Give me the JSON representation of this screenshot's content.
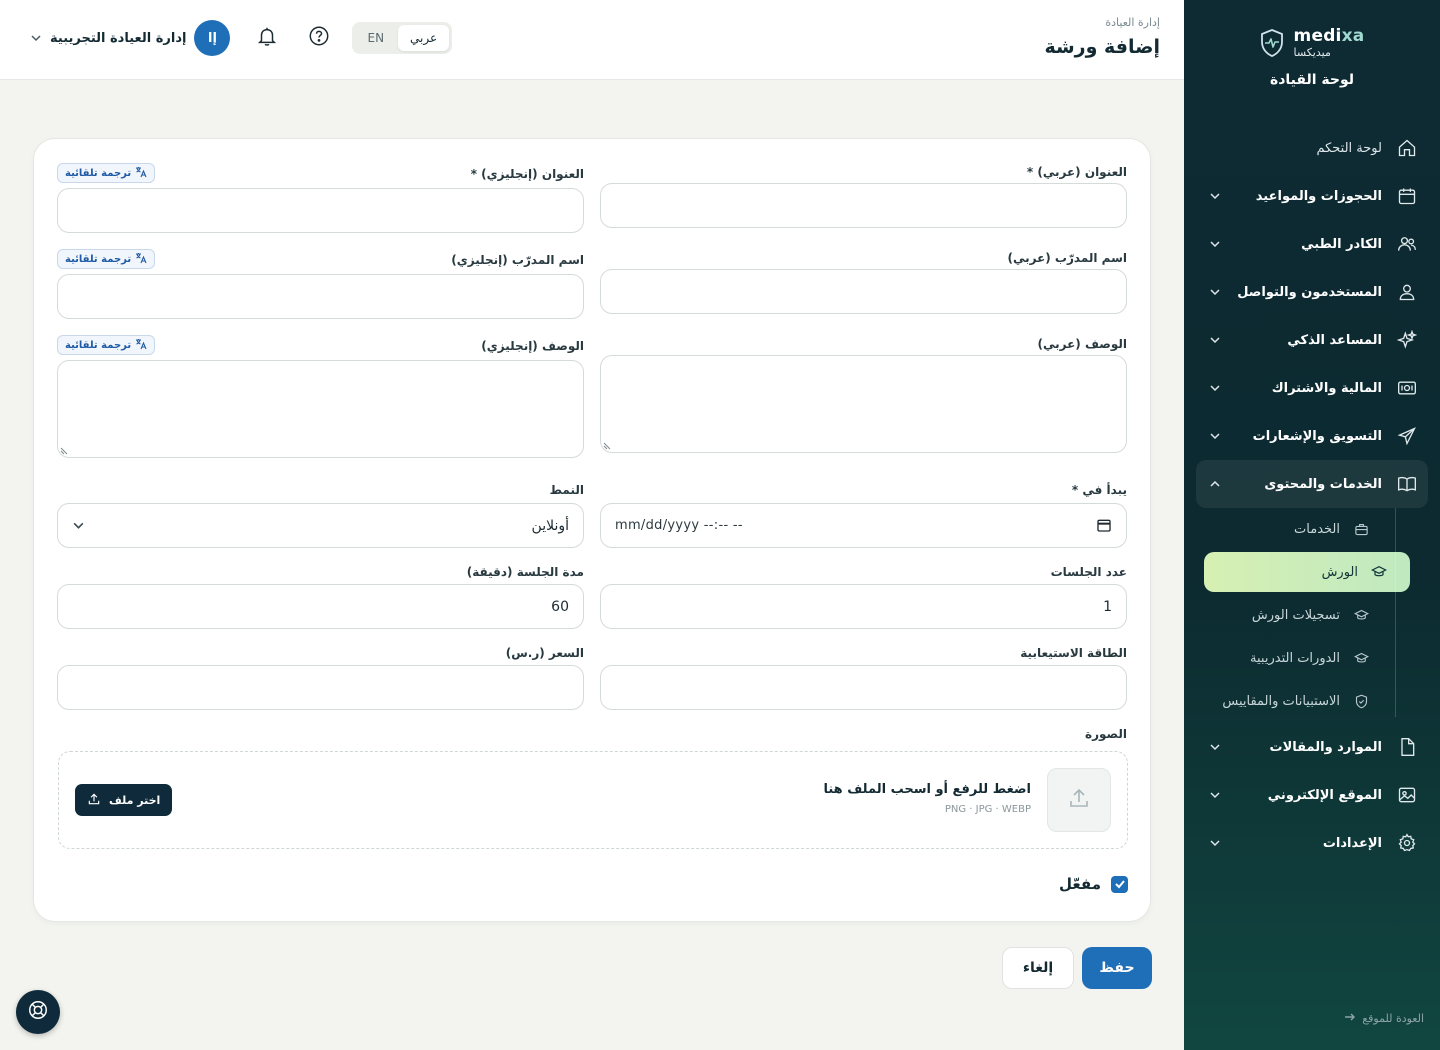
{
  "brand": {
    "name_en_a": "medi",
    "name_en_b": "xa",
    "name_ar": "ميديكسا",
    "subtitle": "لوحة القيادة"
  },
  "sidebar": {
    "items": [
      {
        "label": "لوحة التحكم",
        "icon": "home-icon"
      },
      {
        "label": "الحجوزات والمواعيد",
        "icon": "calendar-icon"
      },
      {
        "label": "الكادر الطبي",
        "icon": "users-icon"
      },
      {
        "label": "المستخدمون والتواصل",
        "icon": "user-icon"
      },
      {
        "label": "المساعد الذكي",
        "icon": "sparkles-icon"
      },
      {
        "label": "المالية والاشتراك",
        "icon": "money-icon"
      },
      {
        "label": "التسويق والإشعارات",
        "icon": "send-icon"
      },
      {
        "label": "الخدمات والمحتوى",
        "icon": "book-icon"
      },
      {
        "label": "الموارد والمقالات",
        "icon": "file-icon"
      },
      {
        "label": "الموقع الإلكتروني",
        "icon": "image-icon"
      },
      {
        "label": "الإعدادات",
        "icon": "gear-icon"
      }
    ],
    "sub_items": [
      {
        "label": "الخدمات",
        "icon": "briefcase-icon"
      },
      {
        "label": "الورش",
        "icon": "graduation-cap-icon",
        "active": true
      },
      {
        "label": "تسجيلات الورش",
        "icon": "graduation-cap-icon"
      },
      {
        "label": "الدورات التدريبية",
        "icon": "graduation-cap-icon"
      },
      {
        "label": "الاستبيانات والمقاييس",
        "icon": "shield-check-icon"
      }
    ],
    "back_link": "العودة للموقع"
  },
  "header": {
    "breadcrumb": "إدارة العيادة",
    "title": "إضافة ورشة",
    "user_name": "إدارة العيادة التجريبية",
    "avatar_initials": "إا",
    "lang_ar": "عربي",
    "lang_en": "EN"
  },
  "form": {
    "title_ar_label": "العنوان (عربي) *",
    "title_en_label": "العنوان (إنجليزي) *",
    "trainer_ar_label": "اسم المدرّب (عربي)",
    "trainer_en_label": "اسم المدرّب (إنجليزي)",
    "desc_ar_label": "الوصف (عربي)",
    "desc_en_label": "الوصف (إنجليزي)",
    "auto_translate": "ترجمة تلقائية",
    "starts_at_label": "يبدأ في *",
    "starts_at_value": "mm/dd/yyyy --:-- --",
    "mode_label": "النمط",
    "mode_value": "أونلاين",
    "sessions_count_label": "عدد الجلسات",
    "sessions_count_value": "1",
    "session_duration_label": "مدة الجلسة (دقيقة)",
    "session_duration_value": "60",
    "capacity_label": "الطاقة الاستيعابية",
    "price_label": "السعر (ر.س)",
    "image_label": "الصورة",
    "upload_title": "اضغط للرفع أو اسحب الملف هنا",
    "upload_formats": "PNG · JPG · WEBP",
    "choose_file": "اختر ملف",
    "active_label": "مفعّل",
    "active_checked": true
  },
  "actions": {
    "save": "حفظ",
    "cancel": "إلغاء"
  },
  "colors": {
    "primary": "#1f6fb8",
    "sidebar_bg": "#0e2a33",
    "active_item": "#d7f0b3"
  }
}
